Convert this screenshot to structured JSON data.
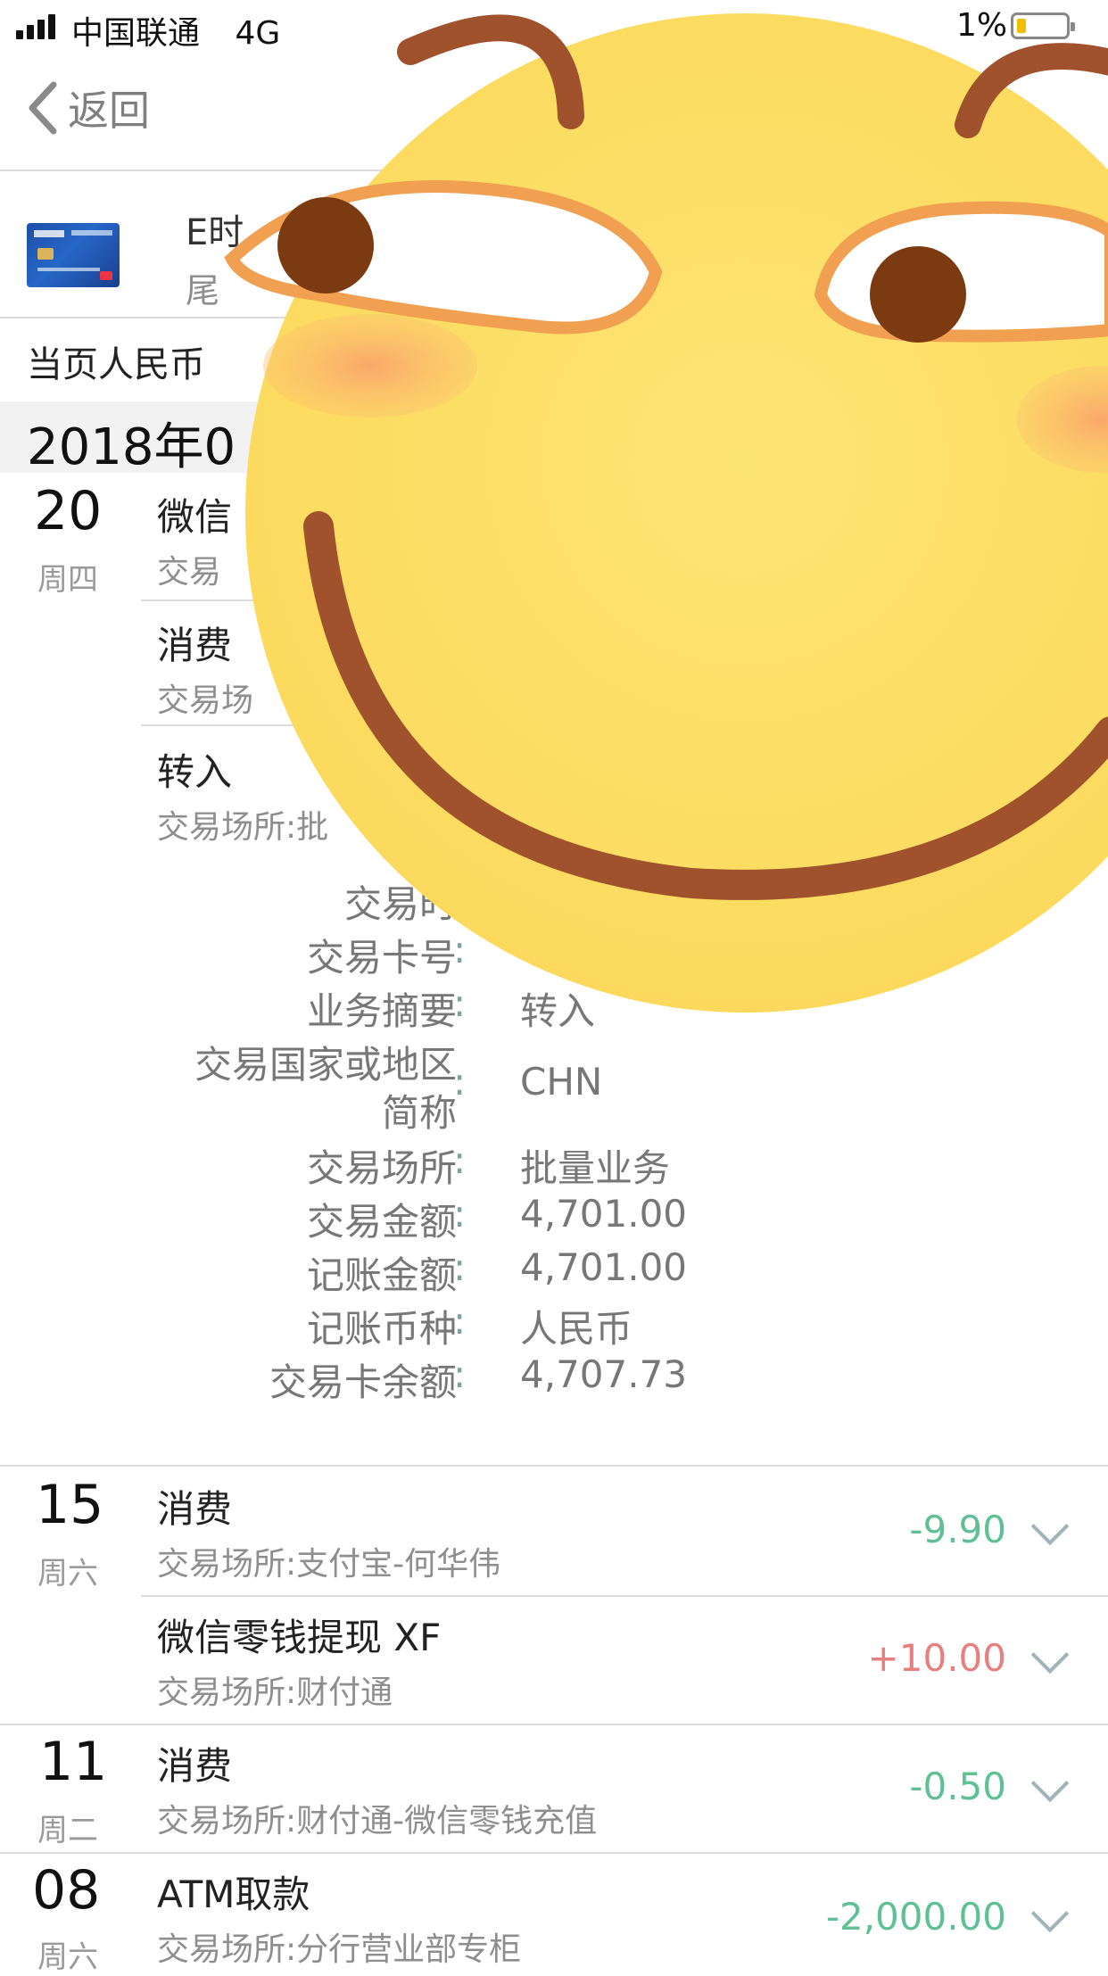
{
  "status_bar": {
    "carrier": "中国联通",
    "network": "4G",
    "battery_pct": "1%"
  },
  "nav": {
    "back_label": "返回"
  },
  "card": {
    "name": "E时",
    "tail_prefix": "尾"
  },
  "summary_text": "当页人民币",
  "month_label": "2018年0",
  "day_groups": [
    {
      "day": "20",
      "weekday": "周四",
      "transactions": [
        {
          "title": "微信",
          "place": "交易"
        },
        {
          "title": "消费",
          "place": "交易场"
        },
        {
          "title": "转入",
          "place": "交易场所:批"
        }
      ]
    },
    {
      "day": "15",
      "weekday": "周六",
      "transactions": [
        {
          "title": "消费",
          "place": "交易场所:支付宝-何华伟",
          "amount": "-9.90"
        },
        {
          "title": "微信零钱提现 XF",
          "place": "交易场所:财付通",
          "amount": "+10.00"
        }
      ]
    },
    {
      "day": "11",
      "weekday": "周二",
      "transactions": [
        {
          "title": "消费",
          "place": "交易场所:财付通-微信零钱充值",
          "amount": "-0.50"
        }
      ]
    },
    {
      "day": "08",
      "weekday": "周六",
      "transactions": [
        {
          "title": "ATM取款",
          "place": "交易场所:分行营业部专柜",
          "amount": "-2,000.00"
        }
      ]
    }
  ],
  "details": [
    {
      "label": "交易时",
      "colon": "",
      "value": ""
    },
    {
      "label": "交易卡号",
      "colon": ":",
      "value": ""
    },
    {
      "label": "业务摘要",
      "colon": ":",
      "value": "转入"
    },
    {
      "label_line1": "交易国家或地区",
      "label_line2": "简称",
      "colon": ":",
      "value": "CHN"
    },
    {
      "label": "交易场所",
      "colon": ":",
      "value": "批量业务"
    },
    {
      "label": "交易金额",
      "colon": ":",
      "value": "4,701.00"
    },
    {
      "label": "记账金额",
      "colon": ":",
      "value": "4,701.00"
    },
    {
      "label": "记账币种",
      "colon": ":",
      "value": "人民币"
    },
    {
      "label": "交易卡余额",
      "colon": ":",
      "value": "4,707.73"
    }
  ],
  "colors": {
    "negative_amount": "#5fbf95",
    "positive_amount": "#e77f7f",
    "emoji_face": "#fde06a",
    "emoji_brow": "#a0522d"
  },
  "icons": [
    "signal-icon",
    "battery-icon",
    "back-chevron-icon",
    "bank-card-icon",
    "expand-chevron-icon",
    "smirk-emoji-sticker"
  ]
}
